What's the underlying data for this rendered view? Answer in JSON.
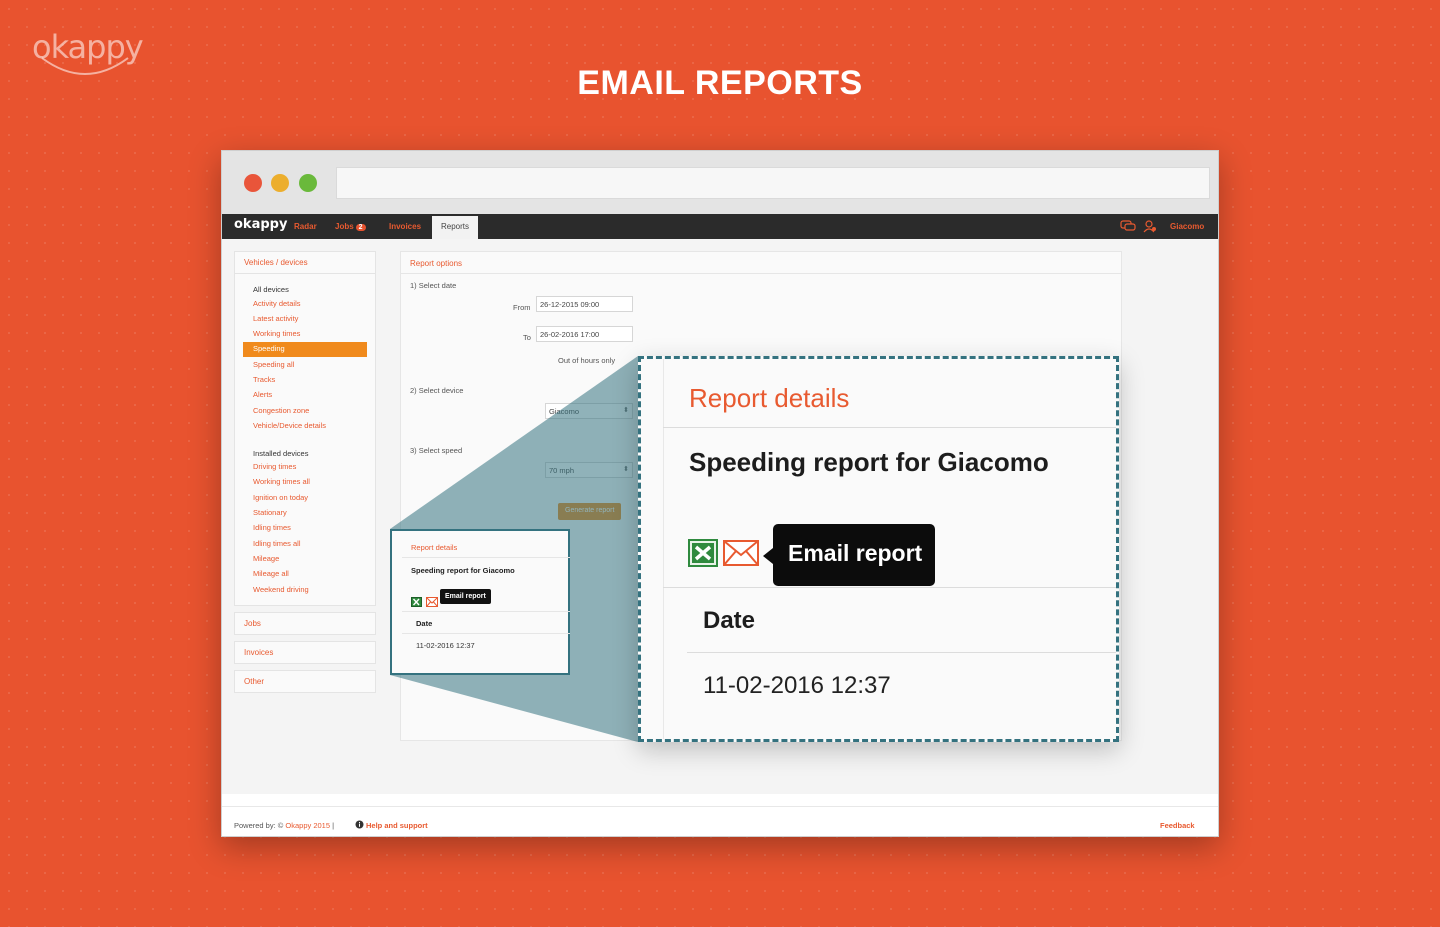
{
  "brand": {
    "logo_text": "okappy"
  },
  "hero": {
    "title": "EMAIL REPORTS"
  },
  "app": {
    "logo_text": "okappy",
    "nav": {
      "radar": "Radar",
      "jobs": "Jobs",
      "jobs_badge": "2",
      "invoices": "Invoices",
      "reports": "Reports",
      "user": "Giacomo"
    },
    "sidebar": {
      "vehicles_header": "Vehicles / devices",
      "all_devices_label": "All devices",
      "all_devices_items": [
        {
          "label": "Activity details",
          "active": false
        },
        {
          "label": "Latest activity",
          "active": false
        },
        {
          "label": "Working times",
          "active": false
        },
        {
          "label": "Speeding",
          "active": true
        },
        {
          "label": "Speeding all",
          "active": false
        },
        {
          "label": "Tracks",
          "active": false
        },
        {
          "label": "Alerts",
          "active": false
        },
        {
          "label": "Congestion zone",
          "active": false
        },
        {
          "label": "Vehicle/Device details",
          "active": false
        }
      ],
      "installed_label": "Installed devices",
      "installed_items": [
        "Driving times",
        "Working times all",
        "Ignition on today",
        "Stationary",
        "Idling times",
        "Idling times all",
        "Mileage",
        "Mileage all",
        "Weekend driving"
      ],
      "jobs": "Jobs",
      "invoices": "Invoices",
      "other": "Other"
    },
    "report_options": {
      "title": "Report options",
      "select_date": "1) Select date",
      "from_label": "From",
      "from_value": "26-12-2015 09:00",
      "to_label": "To",
      "to_value": "26-02-2016 17:00",
      "out_of_hours": "Out of hours only",
      "select_device": "2) Select device",
      "device_value": "Giacomo",
      "select_speed": "3) Select speed",
      "speed_value": "70 mph",
      "generate_button": "Generate report"
    },
    "report_details": {
      "title": "Report details",
      "heading": "Speeding report for Giacomo",
      "email_tooltip": "Email report",
      "date_label": "Date",
      "date_value": "11-02-2016 12:37"
    },
    "footer": {
      "powered_by": "Powered by: © ",
      "powered_brand": "Okappy 2015",
      "separator": " |",
      "help": "Help and support",
      "feedback": "Feedback"
    }
  },
  "colors": {
    "background": "#e8532f",
    "accent": "#e85a30",
    "active_item": "#f08a1c",
    "magnifier_teal": "#34727f",
    "nav_bar": "#2b2b2b"
  },
  "icons": [
    "window-close-dot",
    "window-minimize-dot",
    "window-maximize-dot",
    "chat-icon",
    "user-alert-icon",
    "excel-icon",
    "email-icon",
    "info-icon"
  ]
}
